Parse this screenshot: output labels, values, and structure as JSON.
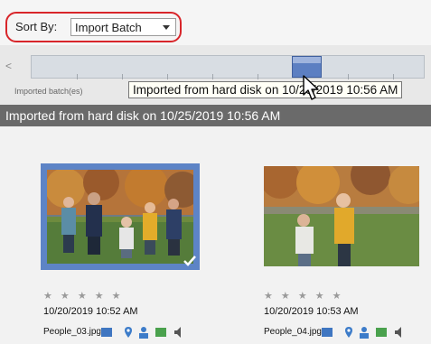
{
  "sort": {
    "label": "Sort By:",
    "value": "Import Batch"
  },
  "timeline": {
    "scroll_left_glyph": "<",
    "section_label": "Imported batch(es)"
  },
  "tooltip": {
    "text": "Imported from hard disk on 10/25/2019 10:56 AM"
  },
  "group": {
    "header": "Imported from hard disk on 10/25/2019 10:56 AM"
  },
  "photos": [
    {
      "date": "10/20/2019 10:52 AM",
      "filename": "People_03.jpg",
      "rating": "★ ★ ★ ★ ★",
      "selected": true
    },
    {
      "date": "10/20/2019 10:53 AM",
      "filename": "People_04.jpg",
      "rating": "★ ★ ★ ★ ★",
      "selected": false
    }
  ],
  "colors": {
    "accent": "#5d84c6",
    "header_bg": "#6a6a6a",
    "highlight": "#d8252a"
  },
  "icons": [
    "chevron-down-icon",
    "cursor-arrow-icon",
    "check-icon",
    "map-pin-icon",
    "people-icon",
    "video-icon",
    "audio-icon"
  ]
}
